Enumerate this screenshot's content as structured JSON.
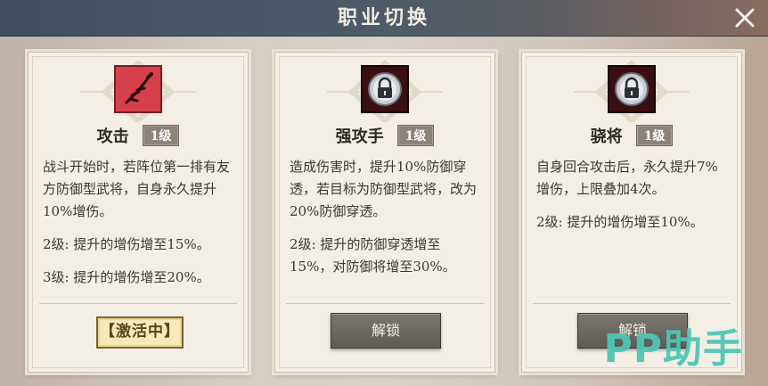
{
  "window": {
    "title": "职业切换"
  },
  "cards": [
    {
      "name": "攻击",
      "level": "1级",
      "icon": "sword-slash-icon",
      "desc": [
        "战斗开始时，若阵位第一排有友方防御型武将，自身永久提升10%增伤。",
        "2级: 提升的增伤增至15%。",
        "3级: 提升的增伤增至20%。"
      ],
      "action": "【激活中】",
      "action_type": "active"
    },
    {
      "name": "强攻手",
      "level": "1级",
      "icon": "lock-icon",
      "desc": [
        "造成伤害时，提升10%防御穿透，若目标为防御型武将，改为20%防御穿透。",
        "2级: 提升的防御穿透增至15%，对防御将增至30%。"
      ],
      "action": "解锁",
      "action_type": "unlock"
    },
    {
      "name": "骁将",
      "level": "1级",
      "icon": "lock-icon",
      "desc": [
        "自身回合攻击后，永久提升7%增伤，上限叠加4次。",
        "2级: 提升的增伤增至10%。"
      ],
      "action": "解锁",
      "action_type": "unlock"
    }
  ],
  "watermark": {
    "text": "PP助手"
  },
  "colors": {
    "active_bg": "#f7e9b8",
    "unlock_bg": "#6b6762",
    "attack_icon_bg": "#d6404a",
    "lock_icon_bg": "#3a0f12"
  }
}
